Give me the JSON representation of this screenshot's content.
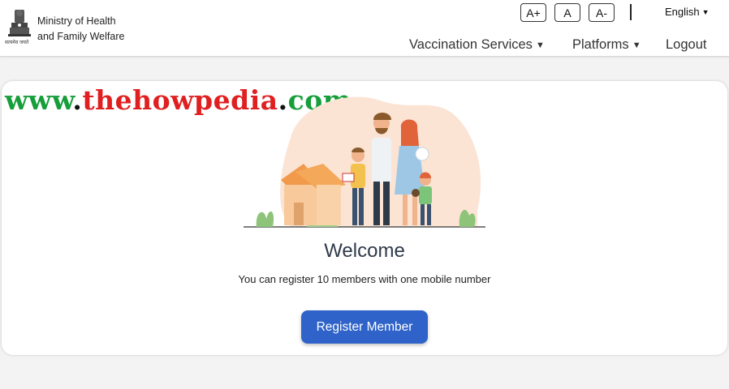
{
  "header": {
    "ministry_line1": "Ministry of Health",
    "ministry_line2": "and Family Welfare",
    "emblem_motto": "सत्यमेव जयते",
    "font_controls": [
      "A+",
      "A",
      "A-"
    ],
    "language": "English",
    "nav": {
      "vaccination_services": "Vaccination Services",
      "platforms": "Platforms",
      "logout": "Logout"
    }
  },
  "watermark": {
    "www": "www",
    "dot1": ".",
    "name": "thehowpedia",
    "dot2": ".",
    "com": "com"
  },
  "main": {
    "welcome": "Welcome",
    "subtitle": "You can register 10 members with one mobile number",
    "register_button": "Register Member"
  },
  "icons": [
    "emblem-icon",
    "chevron-down-icon",
    "family-illustration"
  ],
  "colors": {
    "primary_button": "#2f63c9",
    "watermark_green": "#159e3a",
    "watermark_red": "#e02020",
    "card_bg": "#ffffff",
    "page_bg": "#f3f3f3"
  }
}
